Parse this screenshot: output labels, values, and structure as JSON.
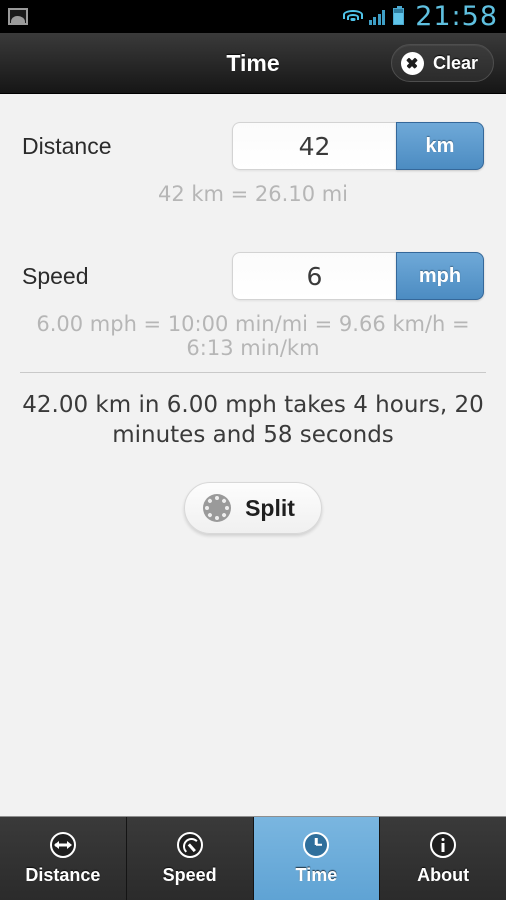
{
  "status_bar": {
    "icons": [
      "gallery-icon",
      "wifi-icon",
      "signal-icon",
      "battery-icon"
    ],
    "time": "21:58"
  },
  "header": {
    "title": "Time",
    "clear_label": "Clear",
    "clear_icon": "close-circle-icon"
  },
  "main": {
    "distance": {
      "label": "Distance",
      "value": "42",
      "unit": "km",
      "conversion": "42 km = 26.10 mi"
    },
    "speed": {
      "label": "Speed",
      "value": "6",
      "unit": "mph",
      "conversion": "6.00 mph = 10:00 min/mi = 9.66 km/h = 6:13 min/km"
    },
    "result": "42.00 km in 6.00 mph takes 4 hours, 20 minutes and 58 seconds",
    "split": {
      "label": "Split",
      "icon": "stopwatch-icon"
    }
  },
  "tabs": [
    {
      "label": "Distance",
      "icon": "arrows-horizontal-icon",
      "active": false
    },
    {
      "label": "Speed",
      "icon": "speedometer-icon",
      "active": false
    },
    {
      "label": "Time",
      "icon": "clock-icon",
      "active": true
    },
    {
      "label": "About",
      "icon": "info-icon",
      "active": false
    }
  ],
  "colors": {
    "accent_blue": "#5b9bd0",
    "active_tab": "#6fb0dd",
    "background": "#f2f2f2",
    "muted_text": "#b6b6b6"
  }
}
